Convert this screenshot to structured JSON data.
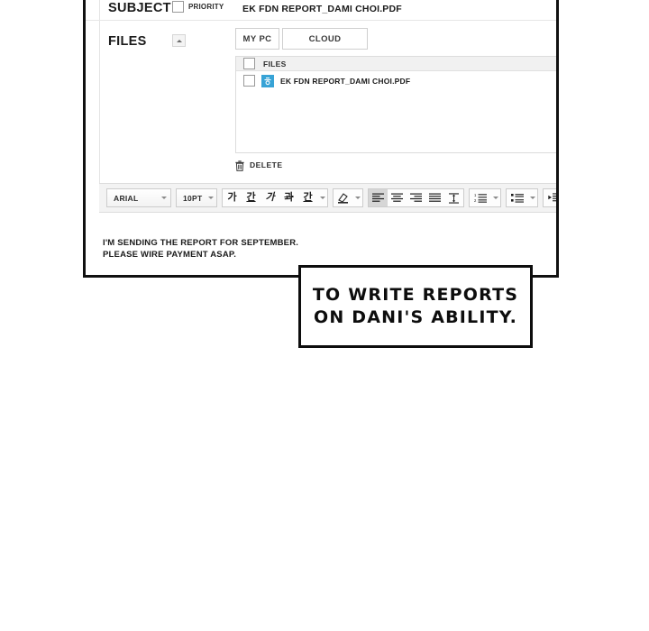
{
  "compose": {
    "subject": {
      "label": "SUBJECT",
      "value": "EK FDN REPORT_DAMI CHOI.PDF",
      "placeholder": "",
      "priority_label": "PRIORITY"
    },
    "files": {
      "label": "FILES",
      "collapse_icon": "caret-up-icon",
      "tabs": [
        {
          "id": "mypc",
          "label": "MY PC"
        },
        {
          "id": "cloud",
          "label": "CLOUD"
        }
      ],
      "list_header": "FILES",
      "items": [
        {
          "name": "EK FDN REPORT_DAMI CHOI.PDF",
          "icon": "pdf-file-icon"
        }
      ],
      "delete_label": "DELETE",
      "delete_icon": "trash-icon"
    },
    "editor": {
      "font_family": "ARIAL",
      "font_size": "10PT",
      "format_buttons": [
        {
          "id": "bold",
          "glyph": "가"
        },
        {
          "id": "underline",
          "glyph": "간"
        },
        {
          "id": "italic",
          "glyph": "가"
        },
        {
          "id": "strikethrough",
          "glyph": "과"
        },
        {
          "id": "text-color",
          "glyph": "간"
        }
      ],
      "align_buttons": [
        {
          "id": "align-left",
          "active": true
        },
        {
          "id": "align-center",
          "active": false
        },
        {
          "id": "align-right",
          "active": false
        },
        {
          "id": "align-justify",
          "active": false
        },
        {
          "id": "line-height",
          "active": false
        }
      ],
      "body_lines": [
        "I'M SENDING THE REPORT FOR SEPTEMBER.",
        "PLEASE WIRE PAYMENT ASAP."
      ]
    }
  },
  "caption": {
    "lines": [
      "TO WRITE REPORTS",
      "ON DANI'S ABILITY."
    ]
  },
  "colors": {
    "panel_border": "#111111",
    "file_icon": "#37a3d6",
    "toolbar_bg": "#f3f3f3",
    "list_header_bg": "#f1f1f1"
  }
}
